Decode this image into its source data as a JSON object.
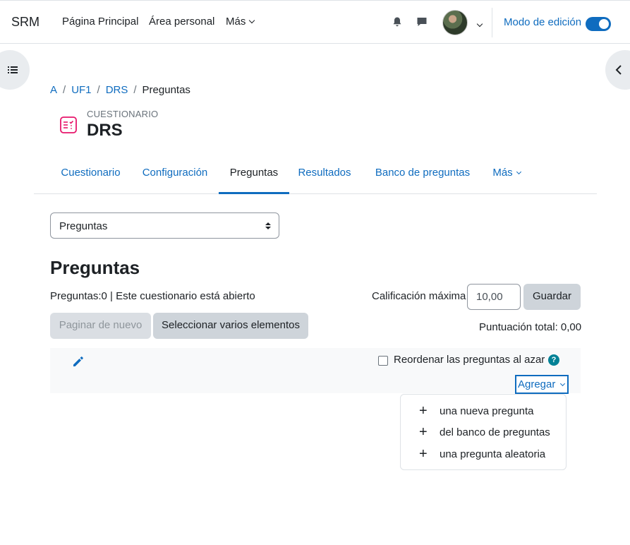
{
  "navbar": {
    "brand": "SRM",
    "links": [
      "Página Principal",
      "Área personal",
      "Más"
    ],
    "edit_mode_label": "Modo de edición",
    "edit_mode_on": true,
    "accent": "#0f6cbf"
  },
  "breadcrumb": [
    "A",
    "UF1",
    "DRS",
    "Preguntas"
  ],
  "header": {
    "module_type": "CUESTIONARIO",
    "title": "DRS",
    "icon": "quiz-icon",
    "icon_color": "#e7166b"
  },
  "tabs": [
    {
      "label": "Cuestionario",
      "active": false
    },
    {
      "label": "Configuración",
      "active": false
    },
    {
      "label": "Preguntas",
      "active": true
    },
    {
      "label": "Resultados",
      "active": false
    },
    {
      "label": "Banco de preguntas",
      "active": false
    },
    {
      "label": "Más",
      "active": false
    }
  ],
  "page_select": {
    "value": "Preguntas"
  },
  "main": {
    "heading": "Preguntas",
    "info": "Preguntas:0 | Este cuestionario está abierto",
    "max_grade_label": "Calificación máxima",
    "max_grade_value": "10,00",
    "save_label": "Guardar",
    "repaginate_label": "Paginar de nuevo",
    "select_multiple_label": "Seleccionar varios elementos",
    "total_score": "Puntuación total: 0,00"
  },
  "section": {
    "shuffle_label": "Reordenar las preguntas al azar",
    "shuffle_checked": false,
    "help_glyph": "?",
    "add_label": "Agregar"
  },
  "add_menu": {
    "items": [
      "una nueva pregunta",
      "del banco de preguntas",
      "una pregunta aleatoria"
    ],
    "plus_glyph": "+"
  }
}
